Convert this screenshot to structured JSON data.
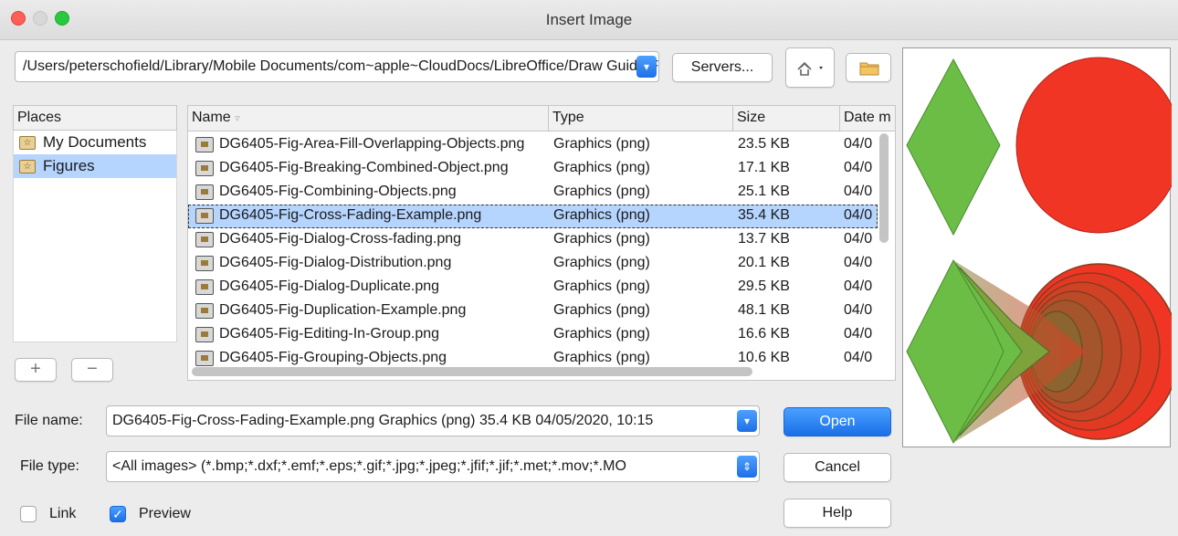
{
  "window": {
    "title": "Insert Image"
  },
  "toolbar": {
    "path": "/Users/peterschofield/Library/Mobile Documents/com~apple~CloudDocs/LibreOffice/Draw Guide/Figures",
    "servers_label": "Servers...",
    "up_icon": "up-folder-icon",
    "new_folder_icon": "new-folder-icon"
  },
  "places": {
    "header": "Places",
    "items": [
      {
        "label": "My Documents",
        "selected": false
      },
      {
        "label": "Figures",
        "selected": true
      }
    ],
    "add_label": "+",
    "remove_label": "−"
  },
  "files": {
    "columns": [
      "Name",
      "Type",
      "Size",
      "Date m"
    ],
    "rows": [
      {
        "name": "DG6405-Fig-Area-Fill-Overlapping-Objects.png",
        "type": "Graphics (png)",
        "size": "23.5 KB",
        "date": "04/0"
      },
      {
        "name": "DG6405-Fig-Breaking-Combined-Object.png",
        "type": "Graphics (png)",
        "size": "17.1 KB",
        "date": "04/0"
      },
      {
        "name": "DG6405-Fig-Combining-Objects.png",
        "type": "Graphics (png)",
        "size": "25.1 KB",
        "date": "04/0"
      },
      {
        "name": "DG6405-Fig-Cross-Fading-Example.png",
        "type": "Graphics (png)",
        "size": "35.4 KB",
        "date": "04/0",
        "selected": true
      },
      {
        "name": "DG6405-Fig-Dialog-Cross-fading.png",
        "type": "Graphics (png)",
        "size": "13.7 KB",
        "date": "04/0"
      },
      {
        "name": "DG6405-Fig-Dialog-Distribution.png",
        "type": "Graphics (png)",
        "size": "20.1 KB",
        "date": "04/0"
      },
      {
        "name": "DG6405-Fig-Dialog-Duplicate.png",
        "type": "Graphics (png)",
        "size": "29.5 KB",
        "date": "04/0"
      },
      {
        "name": "DG6405-Fig-Duplication-Example.png",
        "type": "Graphics (png)",
        "size": "48.1 KB",
        "date": "04/0"
      },
      {
        "name": "DG6405-Fig-Editing-In-Group.png",
        "type": "Graphics (png)",
        "size": "16.6 KB",
        "date": "04/0"
      },
      {
        "name": "DG6405-Fig-Grouping-Objects.png",
        "type": "Graphics (png)",
        "size": "10.6 KB",
        "date": "04/0"
      }
    ]
  },
  "form": {
    "file_name_label": "File name:",
    "file_name_value": "DG6405-Fig-Cross-Fading-Example.png Graphics (png) 35.4 KB 04/05/2020, 10:15",
    "file_type_label": "File type:",
    "file_type_value": "<All images> (*.bmp;*.dxf;*.emf;*.eps;*.gif;*.jpg;*.jpeg;*.jfif;*.jif;*.met;*.mov;*.MO",
    "open_label": "Open",
    "cancel_label": "Cancel",
    "help_label": "Help",
    "link_label": "Link",
    "link_checked": false,
    "preview_label": "Preview",
    "preview_checked": true
  },
  "colors": {
    "accent": "#1a6fe8",
    "selection": "#b5d5ff",
    "diamond": "#6cbd45",
    "circle": "#f03524"
  }
}
